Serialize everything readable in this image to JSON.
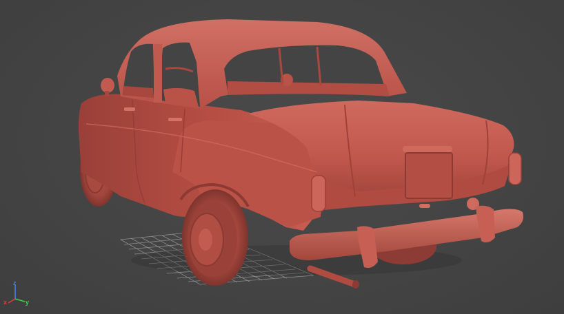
{
  "viewport": {
    "background": "#444444",
    "grid_color": "#9a9a9a",
    "model_color": "#c2584d",
    "model_shadow": "#8e3a34",
    "model_highlight": "#d8766a"
  },
  "axis_gizmo": {
    "x_label": "x",
    "y_label": "y",
    "z_label": "z",
    "x_color": "#e23b3b",
    "y_color": "#3bd44b",
    "z_color": "#4a7cf0"
  }
}
